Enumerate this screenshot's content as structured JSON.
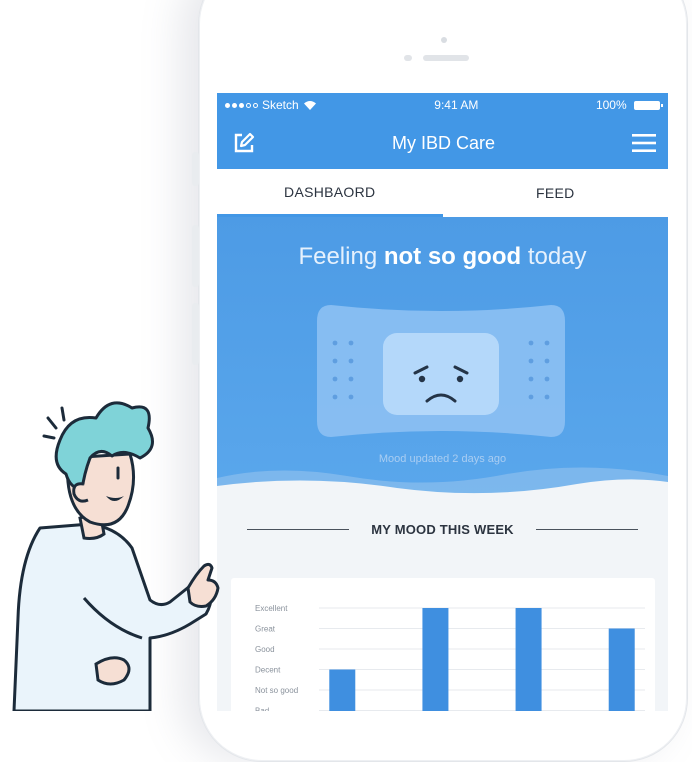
{
  "status_bar": {
    "carrier": "Sketch",
    "time": "9:41 AM",
    "battery": "100%"
  },
  "nav": {
    "title": "My IBD Care",
    "edit_icon": "edit-icon",
    "menu_icon": "menu-icon"
  },
  "tabs": [
    {
      "label": "DASHBAORD",
      "active": true
    },
    {
      "label": "FEED",
      "active": false
    }
  ],
  "hero": {
    "prefix": "Feeling",
    "mood": "not so good",
    "suffix": "today",
    "updated": "Mood updated 2 days ago",
    "illustration": "sad-bandage-icon"
  },
  "mood_section": {
    "title": "MY MOOD THIS WEEK"
  },
  "chart_data": {
    "type": "bar",
    "y_categories": [
      "Excellent",
      "Great",
      "Good",
      "Decent",
      "Not so good",
      "Bad"
    ],
    "values": [
      2,
      0,
      5,
      0,
      5,
      0,
      4
    ],
    "values_note": "mood level index; 5 = Great, 4 = Good, 0 = Bad (bars cropped at bottom)"
  },
  "colors": {
    "accent": "#4297e6",
    "hero_top": "#4d9be5",
    "bar": "#3f8fe0"
  }
}
